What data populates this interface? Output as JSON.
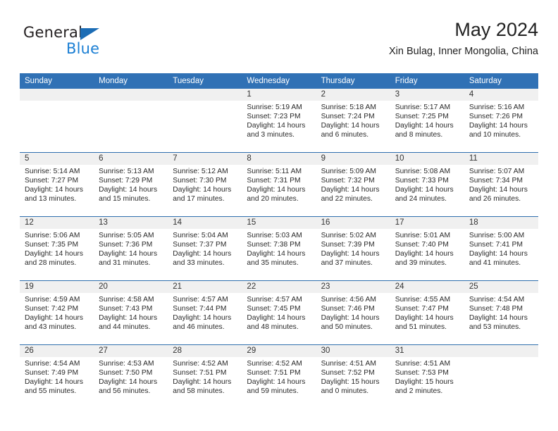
{
  "brand": {
    "name_dark": "General",
    "name_blue": "Blue",
    "triangle_color": "#1b6cb5",
    "blue_color": "#1b7fd4"
  },
  "header": {
    "title": "May 2024",
    "subtitle": "Xin Bulag, Inner Mongolia, China",
    "accent_color": "#3071b5"
  },
  "weekdays": [
    "Sunday",
    "Monday",
    "Tuesday",
    "Wednesday",
    "Thursday",
    "Friday",
    "Saturday"
  ],
  "weeks": [
    [
      {
        "day": "",
        "sunrise": "",
        "sunset": "",
        "daylight_1": "",
        "daylight_2": ""
      },
      {
        "day": "",
        "sunrise": "",
        "sunset": "",
        "daylight_1": "",
        "daylight_2": ""
      },
      {
        "day": "",
        "sunrise": "",
        "sunset": "",
        "daylight_1": "",
        "daylight_2": ""
      },
      {
        "day": "1",
        "sunrise": "Sunrise: 5:19 AM",
        "sunset": "Sunset: 7:23 PM",
        "daylight_1": "Daylight: 14 hours",
        "daylight_2": "and 3 minutes."
      },
      {
        "day": "2",
        "sunrise": "Sunrise: 5:18 AM",
        "sunset": "Sunset: 7:24 PM",
        "daylight_1": "Daylight: 14 hours",
        "daylight_2": "and 6 minutes."
      },
      {
        "day": "3",
        "sunrise": "Sunrise: 5:17 AM",
        "sunset": "Sunset: 7:25 PM",
        "daylight_1": "Daylight: 14 hours",
        "daylight_2": "and 8 minutes."
      },
      {
        "day": "4",
        "sunrise": "Sunrise: 5:16 AM",
        "sunset": "Sunset: 7:26 PM",
        "daylight_1": "Daylight: 14 hours",
        "daylight_2": "and 10 minutes."
      }
    ],
    [
      {
        "day": "5",
        "sunrise": "Sunrise: 5:14 AM",
        "sunset": "Sunset: 7:27 PM",
        "daylight_1": "Daylight: 14 hours",
        "daylight_2": "and 13 minutes."
      },
      {
        "day": "6",
        "sunrise": "Sunrise: 5:13 AM",
        "sunset": "Sunset: 7:29 PM",
        "daylight_1": "Daylight: 14 hours",
        "daylight_2": "and 15 minutes."
      },
      {
        "day": "7",
        "sunrise": "Sunrise: 5:12 AM",
        "sunset": "Sunset: 7:30 PM",
        "daylight_1": "Daylight: 14 hours",
        "daylight_2": "and 17 minutes."
      },
      {
        "day": "8",
        "sunrise": "Sunrise: 5:11 AM",
        "sunset": "Sunset: 7:31 PM",
        "daylight_1": "Daylight: 14 hours",
        "daylight_2": "and 20 minutes."
      },
      {
        "day": "9",
        "sunrise": "Sunrise: 5:09 AM",
        "sunset": "Sunset: 7:32 PM",
        "daylight_1": "Daylight: 14 hours",
        "daylight_2": "and 22 minutes."
      },
      {
        "day": "10",
        "sunrise": "Sunrise: 5:08 AM",
        "sunset": "Sunset: 7:33 PM",
        "daylight_1": "Daylight: 14 hours",
        "daylight_2": "and 24 minutes."
      },
      {
        "day": "11",
        "sunrise": "Sunrise: 5:07 AM",
        "sunset": "Sunset: 7:34 PM",
        "daylight_1": "Daylight: 14 hours",
        "daylight_2": "and 26 minutes."
      }
    ],
    [
      {
        "day": "12",
        "sunrise": "Sunrise: 5:06 AM",
        "sunset": "Sunset: 7:35 PM",
        "daylight_1": "Daylight: 14 hours",
        "daylight_2": "and 28 minutes."
      },
      {
        "day": "13",
        "sunrise": "Sunrise: 5:05 AM",
        "sunset": "Sunset: 7:36 PM",
        "daylight_1": "Daylight: 14 hours",
        "daylight_2": "and 31 minutes."
      },
      {
        "day": "14",
        "sunrise": "Sunrise: 5:04 AM",
        "sunset": "Sunset: 7:37 PM",
        "daylight_1": "Daylight: 14 hours",
        "daylight_2": "and 33 minutes."
      },
      {
        "day": "15",
        "sunrise": "Sunrise: 5:03 AM",
        "sunset": "Sunset: 7:38 PM",
        "daylight_1": "Daylight: 14 hours",
        "daylight_2": "and 35 minutes."
      },
      {
        "day": "16",
        "sunrise": "Sunrise: 5:02 AM",
        "sunset": "Sunset: 7:39 PM",
        "daylight_1": "Daylight: 14 hours",
        "daylight_2": "and 37 minutes."
      },
      {
        "day": "17",
        "sunrise": "Sunrise: 5:01 AM",
        "sunset": "Sunset: 7:40 PM",
        "daylight_1": "Daylight: 14 hours",
        "daylight_2": "and 39 minutes."
      },
      {
        "day": "18",
        "sunrise": "Sunrise: 5:00 AM",
        "sunset": "Sunset: 7:41 PM",
        "daylight_1": "Daylight: 14 hours",
        "daylight_2": "and 41 minutes."
      }
    ],
    [
      {
        "day": "19",
        "sunrise": "Sunrise: 4:59 AM",
        "sunset": "Sunset: 7:42 PM",
        "daylight_1": "Daylight: 14 hours",
        "daylight_2": "and 43 minutes."
      },
      {
        "day": "20",
        "sunrise": "Sunrise: 4:58 AM",
        "sunset": "Sunset: 7:43 PM",
        "daylight_1": "Daylight: 14 hours",
        "daylight_2": "and 44 minutes."
      },
      {
        "day": "21",
        "sunrise": "Sunrise: 4:57 AM",
        "sunset": "Sunset: 7:44 PM",
        "daylight_1": "Daylight: 14 hours",
        "daylight_2": "and 46 minutes."
      },
      {
        "day": "22",
        "sunrise": "Sunrise: 4:57 AM",
        "sunset": "Sunset: 7:45 PM",
        "daylight_1": "Daylight: 14 hours",
        "daylight_2": "and 48 minutes."
      },
      {
        "day": "23",
        "sunrise": "Sunrise: 4:56 AM",
        "sunset": "Sunset: 7:46 PM",
        "daylight_1": "Daylight: 14 hours",
        "daylight_2": "and 50 minutes."
      },
      {
        "day": "24",
        "sunrise": "Sunrise: 4:55 AM",
        "sunset": "Sunset: 7:47 PM",
        "daylight_1": "Daylight: 14 hours",
        "daylight_2": "and 51 minutes."
      },
      {
        "day": "25",
        "sunrise": "Sunrise: 4:54 AM",
        "sunset": "Sunset: 7:48 PM",
        "daylight_1": "Daylight: 14 hours",
        "daylight_2": "and 53 minutes."
      }
    ],
    [
      {
        "day": "26",
        "sunrise": "Sunrise: 4:54 AM",
        "sunset": "Sunset: 7:49 PM",
        "daylight_1": "Daylight: 14 hours",
        "daylight_2": "and 55 minutes."
      },
      {
        "day": "27",
        "sunrise": "Sunrise: 4:53 AM",
        "sunset": "Sunset: 7:50 PM",
        "daylight_1": "Daylight: 14 hours",
        "daylight_2": "and 56 minutes."
      },
      {
        "day": "28",
        "sunrise": "Sunrise: 4:52 AM",
        "sunset": "Sunset: 7:51 PM",
        "daylight_1": "Daylight: 14 hours",
        "daylight_2": "and 58 minutes."
      },
      {
        "day": "29",
        "sunrise": "Sunrise: 4:52 AM",
        "sunset": "Sunset: 7:51 PM",
        "daylight_1": "Daylight: 14 hours",
        "daylight_2": "and 59 minutes."
      },
      {
        "day": "30",
        "sunrise": "Sunrise: 4:51 AM",
        "sunset": "Sunset: 7:52 PM",
        "daylight_1": "Daylight: 15 hours",
        "daylight_2": "and 0 minutes."
      },
      {
        "day": "31",
        "sunrise": "Sunrise: 4:51 AM",
        "sunset": "Sunset: 7:53 PM",
        "daylight_1": "Daylight: 15 hours",
        "daylight_2": "and 2 minutes."
      },
      {
        "day": "",
        "sunrise": "",
        "sunset": "",
        "daylight_1": "",
        "daylight_2": ""
      }
    ]
  ]
}
